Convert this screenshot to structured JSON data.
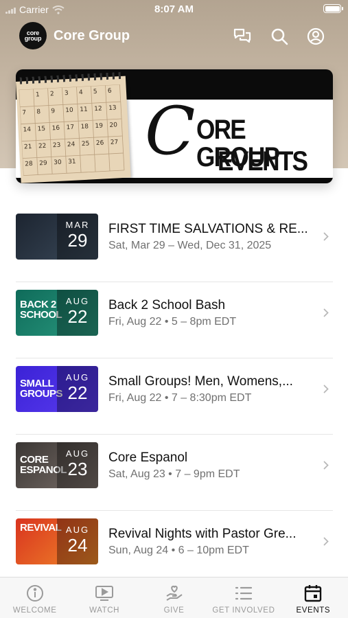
{
  "status_bar": {
    "carrier": "Carrier",
    "time": "8:07 AM"
  },
  "header": {
    "logo_line1": "core",
    "logo_line2": "group",
    "title": "Core Group",
    "icons": [
      "chat-icon",
      "search-icon",
      "account-icon"
    ]
  },
  "banner": {
    "script_letter": "C",
    "title_line1": "ORE GROUP",
    "title_line2": "EVENTS",
    "calendar_numbers": [
      "1",
      "2",
      "3",
      "4",
      "5",
      "6",
      "7",
      "8",
      "9",
      "10",
      "11",
      "12",
      "13",
      "14",
      "15",
      "16",
      "17",
      "18",
      "19",
      "20",
      "21",
      "22",
      "23",
      "24",
      "25",
      "26",
      "27",
      "28",
      "29",
      "30",
      "31"
    ]
  },
  "events": [
    {
      "title": "FIRST TIME SALVATIONS & RE...",
      "when": "Sat, Mar 29 – Wed, Dec 31, 2025",
      "month": "MAR",
      "day": "29",
      "thumb_text": "",
      "colors": [
        "#1c2430",
        "#3b4a5a"
      ]
    },
    {
      "title": "Back 2 School Bash",
      "when": "Fri, Aug 22 • 5 – 8pm EDT",
      "month": "AUG",
      "day": "22",
      "thumb_text": "BACK 2 SCHOOL",
      "colors": [
        "#0f6b5a",
        "#2a9a7f"
      ]
    },
    {
      "title": "Small Groups! Men, Womens,...",
      "when": "Fri, Aug 22 • 7 – 8:30pm EDT",
      "month": "AUG",
      "day": "22",
      "thumb_text": "SMALL GROUPS",
      "colors": [
        "#3b22d6",
        "#5a3cf0"
      ]
    },
    {
      "title": "Core Espanol",
      "when": "Sat, Aug 23 • 7 – 9pm EDT",
      "month": "AUG",
      "day": "23",
      "thumb_text": "CORE ESPANOL",
      "colors": [
        "#3a3634",
        "#7b706a"
      ]
    },
    {
      "title": "Revival Nights with Pastor Gre...",
      "when": "Sun, Aug 24 • 6 – 10pm EDT",
      "month": "AUG",
      "day": "24",
      "thumb_text": "REVIVAL",
      "colors": [
        "#d9341f",
        "#f08a2a"
      ]
    }
  ],
  "tabs": [
    {
      "label": "WELCOME",
      "icon": "info-icon",
      "active": false
    },
    {
      "label": "WATCH",
      "icon": "play-icon",
      "active": false
    },
    {
      "label": "GIVE",
      "icon": "give-icon",
      "active": false
    },
    {
      "label": "GET INVOLVED",
      "icon": "list-icon",
      "active": false
    },
    {
      "label": "EVENTS",
      "icon": "calendar-icon",
      "active": true
    }
  ]
}
